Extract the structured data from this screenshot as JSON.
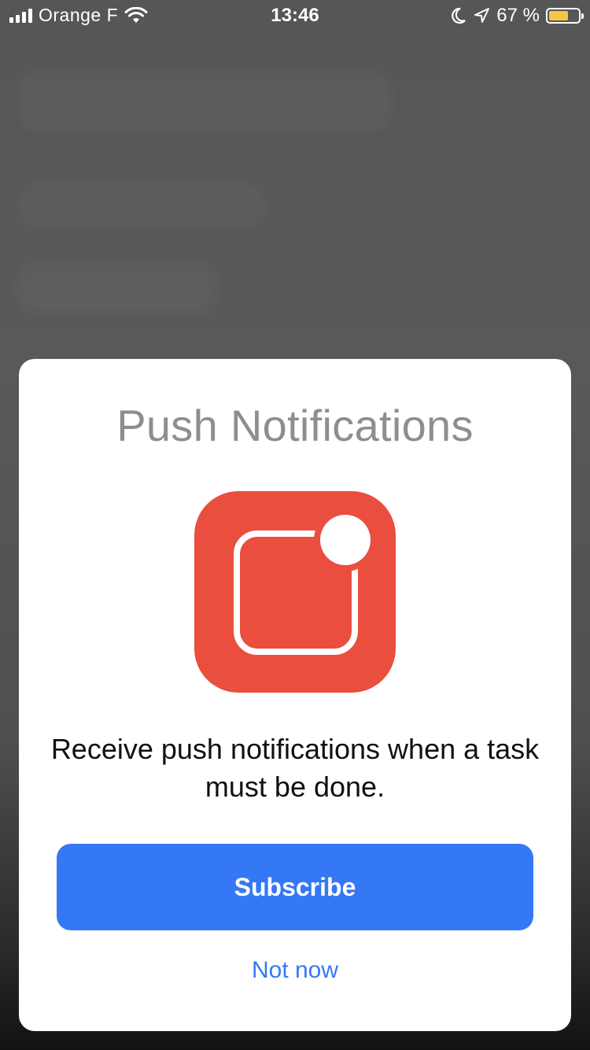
{
  "status_bar": {
    "carrier": "Orange F",
    "time": "13:46",
    "battery_percent": "67 %",
    "battery_level": 0.67,
    "icons": [
      "signal-icon",
      "wifi-icon",
      "moon-icon",
      "location-icon",
      "battery-icon"
    ]
  },
  "dialog": {
    "title": "Push Notifications",
    "icon": "notification-badge-icon",
    "message": "Receive push notifications when a task must be done.",
    "primary_button": "Subscribe",
    "secondary_button": "Not now"
  },
  "colors": {
    "accent": "#3478f6",
    "icon_background": "#e94e3f",
    "battery": "#f7c744",
    "title_text": "#8e8e8e"
  }
}
